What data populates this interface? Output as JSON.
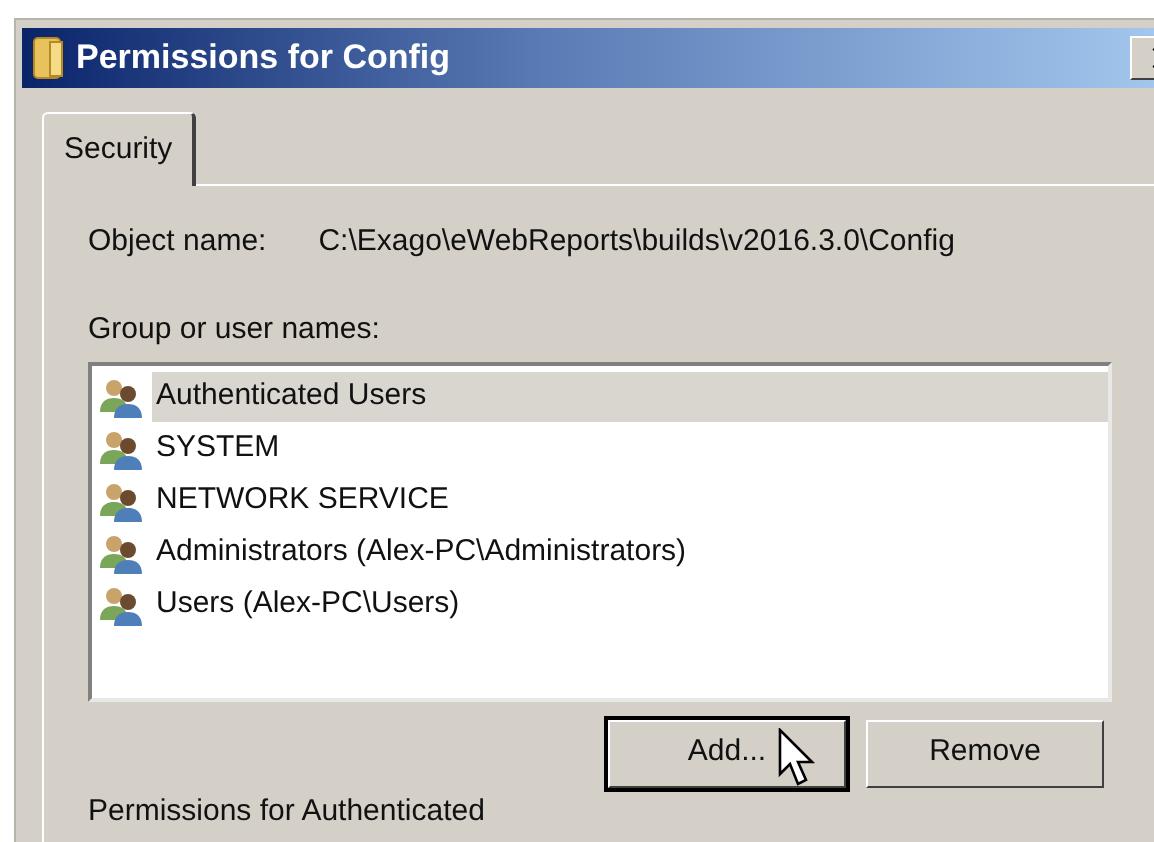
{
  "window": {
    "title": "Permissions for Config"
  },
  "tabs": [
    {
      "label": "Security",
      "selected": true
    }
  ],
  "object_name": {
    "label": "Object name:",
    "value": "C:\\Exago\\eWebReports\\builds\\v2016.3.0\\Config"
  },
  "group_list": {
    "label": "Group or user names:",
    "items": [
      {
        "name": "Authenticated Users",
        "selected": true
      },
      {
        "name": "SYSTEM",
        "selected": false
      },
      {
        "name": "NETWORK SERVICE",
        "selected": false
      },
      {
        "name": "Administrators (Alex-PC\\Administrators)",
        "selected": false
      },
      {
        "name": "Users (Alex-PC\\Users)",
        "selected": false
      }
    ]
  },
  "buttons": [
    {
      "label": "Add...",
      "focused": true
    },
    {
      "label": "Remove",
      "focused": false
    }
  ],
  "permissions_label": "Permissions for Authenticated"
}
